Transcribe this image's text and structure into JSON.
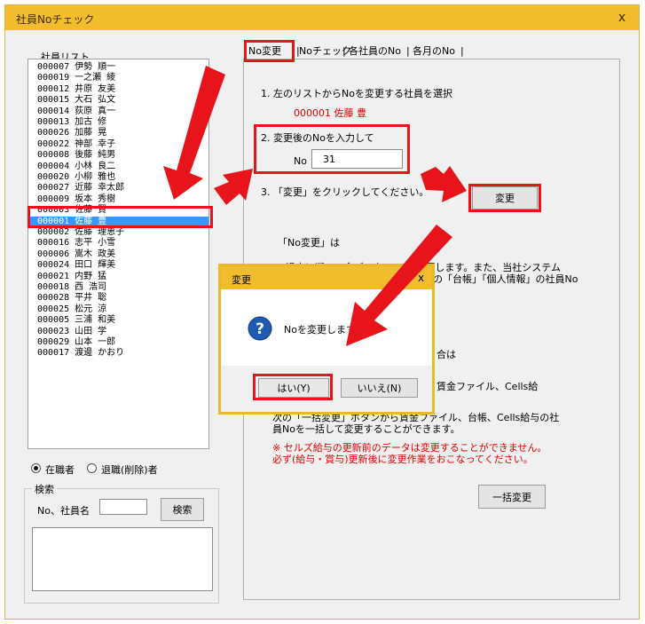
{
  "window": {
    "title": "社員Noチェック",
    "close": "x"
  },
  "left": {
    "list_label": "社員リスト",
    "employees": [
      {
        "no": "000007",
        "name": "伊勢 順一"
      },
      {
        "no": "000019",
        "name": "一之瀬 綾"
      },
      {
        "no": "000012",
        "name": "井原 友美"
      },
      {
        "no": "000015",
        "name": "大石 弘文"
      },
      {
        "no": "000014",
        "name": "荻原 真一"
      },
      {
        "no": "000013",
        "name": "加古 修"
      },
      {
        "no": "000026",
        "name": "加藤 晃"
      },
      {
        "no": "000022",
        "name": "神部 幸子"
      },
      {
        "no": "000008",
        "name": "後藤 純男"
      },
      {
        "no": "000004",
        "name": "小林 良二"
      },
      {
        "no": "000020",
        "name": "小柳 雅也"
      },
      {
        "no": "000027",
        "name": "近藤 幸太郎"
      },
      {
        "no": "000009",
        "name": "坂本 秀樹"
      },
      {
        "no": "000003",
        "name": "佐藤 賢"
      },
      {
        "no": "000001",
        "name": "佐藤 豊"
      },
      {
        "no": "000002",
        "name": "佐藤 理恵子"
      },
      {
        "no": "000016",
        "name": "志平 小雪"
      },
      {
        "no": "000006",
        "name": "嵩木 政美"
      },
      {
        "no": "000024",
        "name": "田口 輝美"
      },
      {
        "no": "000021",
        "name": "内野 猛"
      },
      {
        "no": "000018",
        "name": "西 浩司"
      },
      {
        "no": "000028",
        "name": "平井 聡"
      },
      {
        "no": "000025",
        "name": "松元 涼"
      },
      {
        "no": "000005",
        "name": "三浦 和美"
      },
      {
        "no": "000023",
        "name": "山田 学"
      },
      {
        "no": "000029",
        "name": "山本 一郎"
      },
      {
        "no": "000017",
        "name": "渡邊 かおり"
      }
    ],
    "selected_index": 14,
    "radio_active": "在職者",
    "radio_retired": "退職(削除)者",
    "search_group": "検索",
    "search_label": "No、社員名",
    "search_value": "",
    "search_button": "検索"
  },
  "tabs": [
    "No変更",
    "Noチェック",
    "各社員のNo",
    "各月のNo"
  ],
  "panel": {
    "step1": "1.  左のリストからNoを変更する社員を選択",
    "selected_employee": "000001 佐藤 豊",
    "step2": "2.  変更後のNoを入力して",
    "no_label": "No",
    "no_value": "31",
    "step3": "3.  「変更」をクリックしてください。",
    "change_button": "変更",
    "desc_heading": "「No変更」は",
    "desc_line1": "過去に遡って全データのNoを変更します。また、当社システム",
    "desc_line2": "の「台帳」「個人情報」の社員No",
    "desc_line3": "合は",
    "desc_line4": "賃金ファイル、Cells給",
    "desc_line5": "次の「一括変更」ボタンから賃金ファイル、台帳、Cells給与の社",
    "desc_line6": "員Noを一括して変更することができます。",
    "warn1": "※ セルズ給与の更新前のデータは変更することができません。",
    "warn2": "必ず(給与・賞与)更新後に変更作業をおこなってください。",
    "bulk_button": "一括変更"
  },
  "dialog": {
    "title": "変更",
    "close": "x",
    "icon": "question-icon",
    "message": "Noを変更しますか？",
    "yes": "はい(Y)",
    "no": "いいえ(N)"
  },
  "colors": {
    "titlebar": "#f2bd2c",
    "highlight": "#e8141b",
    "selection": "#3399ff"
  }
}
